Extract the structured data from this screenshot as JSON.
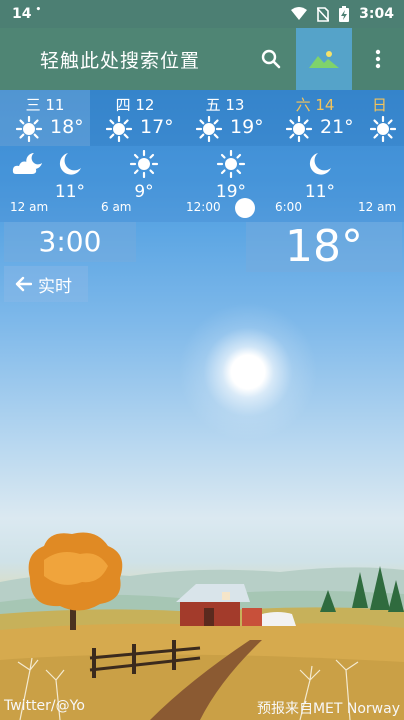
{
  "status_bar": {
    "notification": "14",
    "time": "3:04"
  },
  "app_bar": {
    "search_placeholder": "轻触此处搜索位置",
    "search_icon": "search-icon",
    "landscape_icon": "landscape-icon",
    "more_icon": "more-vert-icon"
  },
  "days": [
    {
      "label": "三 11",
      "icon": "sun-icon",
      "temp": "18°",
      "selected": true
    },
    {
      "label": "四 12",
      "icon": "sun-icon",
      "temp": "17°"
    },
    {
      "label": "五 13",
      "icon": "sun-icon",
      "temp": "19°"
    },
    {
      "label": "六 14",
      "icon": "sun-icon",
      "temp": "21°"
    },
    {
      "label": "日",
      "icon": "sun-icon",
      "temp": ""
    }
  ],
  "hours": [
    {
      "icon": "partly-cloudy-night-icon",
      "temp": "11°"
    },
    {
      "icon": "moon-icon",
      "temp": ""
    },
    {
      "icon": "sun-icon",
      "temp": "9°"
    },
    {
      "icon": "sun-icon",
      "temp": "19°"
    },
    {
      "icon": "moon-icon",
      "temp": "11°"
    }
  ],
  "time_labels": [
    "12 am",
    "6 am",
    "12:00",
    "6:00",
    "12 am"
  ],
  "current": {
    "clock": "3:00",
    "temperature": "18°",
    "realtime_label": "实时"
  },
  "footer": {
    "credit_left": "Twitter/@Yo",
    "credit_right": "预报来自MET Norway"
  },
  "colors": {
    "app_bar": "#4f8574",
    "landscape_button": "#55a3c9",
    "saturday": "#f3c35b"
  }
}
